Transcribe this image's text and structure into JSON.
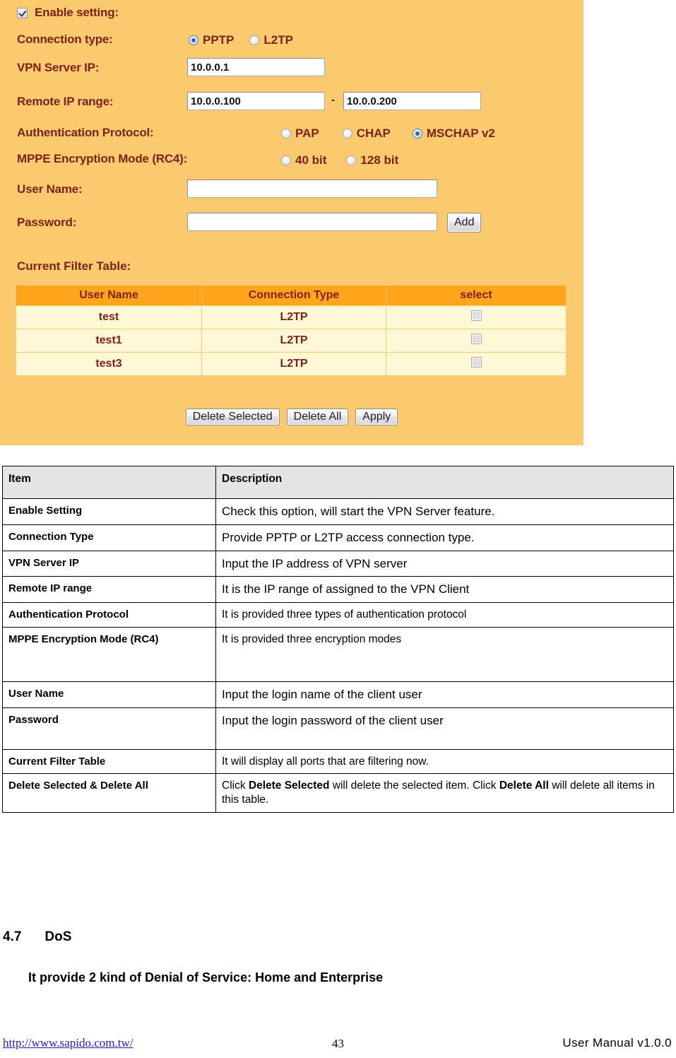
{
  "screenshot_panel": {
    "panel_bg": "#fbca6e",
    "label_color": "#7d2219",
    "enable_setting": {
      "label": "Enable setting:",
      "checked": true
    },
    "connection_type": {
      "label": "Connection type:",
      "options": [
        "PPTP",
        "L2TP"
      ],
      "selected": "PPTP"
    },
    "vpn_server_ip": {
      "label": "VPN Server IP:",
      "value": "10.0.0.1"
    },
    "remote_ip_range": {
      "label": "Remote IP range:",
      "from": "10.0.0.100",
      "separator": "-",
      "to": "10.0.0.200"
    },
    "authentication_protocol": {
      "label": "Authentication Protocol:",
      "options": [
        "PAP",
        "CHAP",
        "MSCHAP v2"
      ],
      "selected": "MSCHAP v2"
    },
    "mppe_encryption_mode": {
      "label": "MPPE Encryption Mode (RC4):",
      "options": [
        "40 bit",
        "128 bit"
      ],
      "selected": ""
    },
    "user_name": {
      "label": "User Name:",
      "value": ""
    },
    "password": {
      "label": "Password:",
      "value": ""
    },
    "add_button": "Add",
    "current_filter_table": {
      "title": "Current Filter Table:",
      "header_bg": "#ffa41b",
      "row_bg": "#fff9d8",
      "columns": [
        "User Name",
        "Connection Type",
        "select"
      ],
      "rows": [
        {
          "user_name": "test",
          "connection_type": "L2TP",
          "selected": false
        },
        {
          "user_name": "test1",
          "connection_type": "L2TP",
          "selected": false
        },
        {
          "user_name": "test3",
          "connection_type": "L2TP",
          "selected": false
        }
      ]
    },
    "buttons": {
      "delete_selected": "Delete Selected",
      "delete_all": "Delete All",
      "apply": "Apply"
    }
  },
  "description_table": {
    "header_bg": "#e5e5e5",
    "columns": [
      "Item",
      "Description"
    ],
    "rows": [
      {
        "item": "Enable Setting",
        "description": "Check this option, will start the VPN Server feature."
      },
      {
        "item": "Connection Type",
        "description": "Provide PPTP or L2TP access connection type."
      },
      {
        "item": "VPN Server IP",
        "description": "Input the IP address of VPN server"
      },
      {
        "item": "Remote IP range",
        "description": "It is the IP range of assigned to the VPN Client"
      },
      {
        "item": "Authentication Protocol",
        "description": "It is provided three types of authentication protocol"
      },
      {
        "item": "MPPE Encryption Mode (RC4)",
        "description": "It is provided three encryption modes"
      },
      {
        "item": "User Name",
        "description": "Input the login name of the client user"
      },
      {
        "item": "Password",
        "description": "Input the login password of the client user"
      },
      {
        "item": "Current Filter Table",
        "description": "It will display all ports that are filtering now."
      },
      {
        "item": "Delete Selected & Delete All",
        "description": "Click Delete Selected will delete the selected item. Click Delete All will delete all items in this table."
      }
    ]
  },
  "section": {
    "number": "4.7",
    "title": "DoS",
    "subtitle": "It provide 2 kind of Denial of Service: Home and Enterprise"
  },
  "footer": {
    "url": "http://www.sapido.com.tw/",
    "page_number": "43",
    "manual": "User  Manual  v1.0.0"
  }
}
